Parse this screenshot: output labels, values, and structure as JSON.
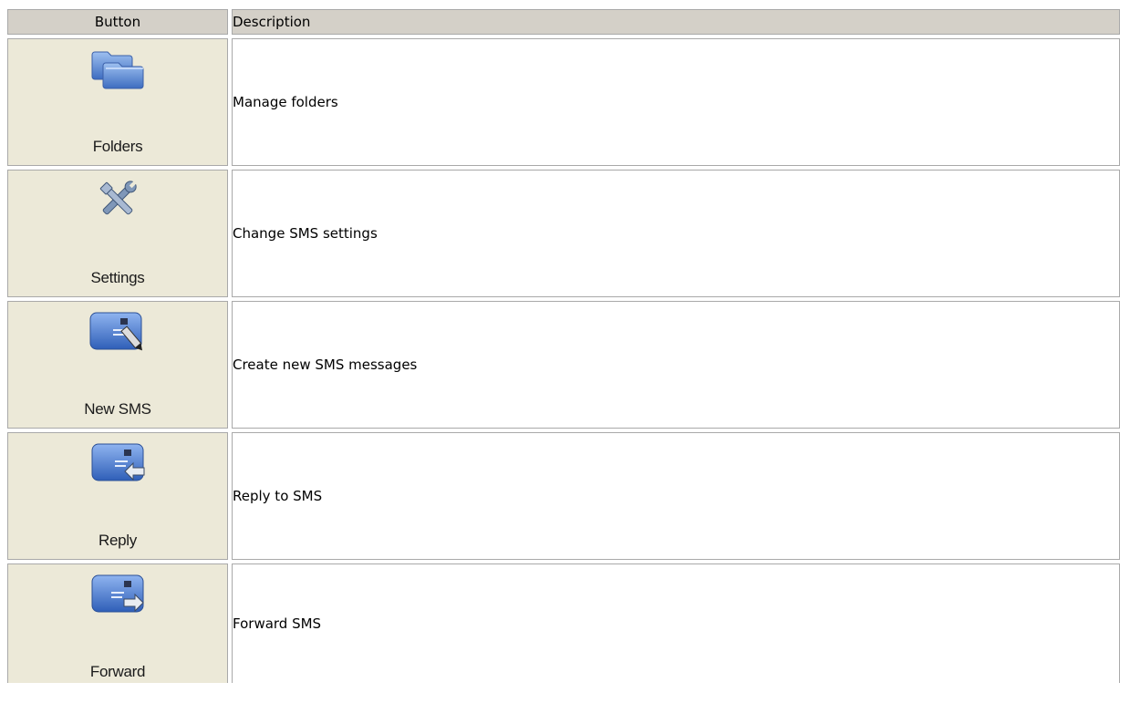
{
  "table": {
    "headers": {
      "button": "Button",
      "description": "Description"
    },
    "rows": [
      {
        "icon": "folders-icon",
        "label": "Folders",
        "description": "Manage folders"
      },
      {
        "icon": "settings-icon",
        "label": "Settings",
        "description": "Change SMS settings"
      },
      {
        "icon": "new-sms-icon",
        "label": "New SMS",
        "description": "Create new SMS messages"
      },
      {
        "icon": "reply-icon",
        "label": "Reply",
        "description": "Reply to SMS"
      },
      {
        "icon": "forward-icon",
        "label": "Forward",
        "description": "Forward SMS"
      }
    ]
  },
  "colors": {
    "header_bg": "#d4d0c8",
    "button_cell_bg": "#ece9d8",
    "border": "#a9a9a9",
    "icon_blue": "#4a78c8"
  }
}
